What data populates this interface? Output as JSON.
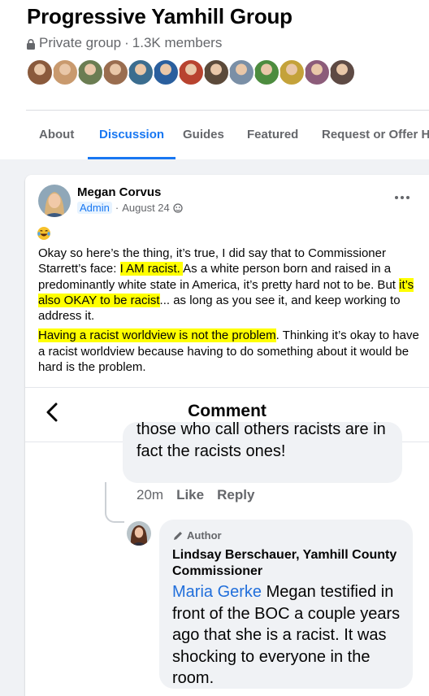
{
  "group": {
    "name": "Progressive Yamhill Group",
    "privacy": "Private group",
    "separator": "·",
    "members": "1.3K members",
    "member_avatar_colors": [
      "#8a5a3c",
      "#c99a6e",
      "#6b7d52",
      "#9a6d4f",
      "#3b6d8f",
      "#2a5f9e",
      "#b8432f",
      "#5c4a3a",
      "#7a8fa6",
      "#4d8c3f",
      "#c4a23a",
      "#8c5c7a",
      "#5e4a44"
    ]
  },
  "tabs": [
    {
      "label": "About",
      "active": false
    },
    {
      "label": "Discussion",
      "active": true
    },
    {
      "label": "Guides",
      "active": false
    },
    {
      "label": "Featured",
      "active": false
    },
    {
      "label": "Request or Offer He",
      "active": false
    }
  ],
  "post": {
    "author": "Megan Corvus",
    "badge": "Admin",
    "date": "August 24",
    "emoji_icon": "laughing-tears-emoji",
    "p1": {
      "a": "Okay so here’s the thing, it’s true, I did say that to Commissioner Starrett’s face: ",
      "hl1": "I AM racist. ",
      "b": " As a white person born and raised in a predominantly white state in America, it’s pretty hard not to be.  But ",
      "hl2": "it’s also OKAY to be racist",
      "c": "... as long as you see it, and keep working to address it."
    },
    "p2": {
      "hl": "Having a racist worldview is not the problem",
      "rest": ".  Thinking it’s okay to have a racist worldview because having to do something about it would be hard is the problem."
    },
    "highlight_color": "#ffff00"
  },
  "comments_panel": {
    "title": "Comment",
    "previous_comment": "those who call others racists are in fact the racists ones!",
    "previous_time": "20m",
    "like_label": "Like",
    "reply_label": "Reply",
    "reply": {
      "author_tag": "Author",
      "name": "Lindsay Berschauer, Yamhill County Commissioner",
      "mention": "Maria Gerke",
      "text": " Megan testified in front of the BOC a couple years ago that she is a racist. It was shocking to everyone in the room."
    }
  }
}
